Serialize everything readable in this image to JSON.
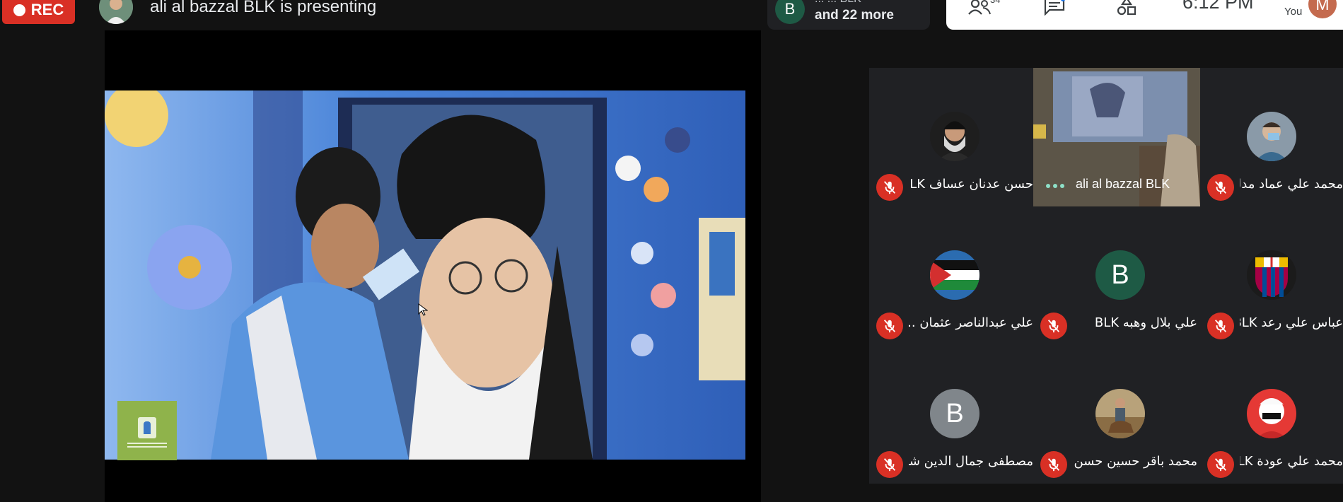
{
  "recording": {
    "label": "REC",
    "color": "#d93025"
  },
  "presenter": {
    "text": "ali al bazzal BLK is presenting"
  },
  "people_chip": {
    "avatar_letter": "B",
    "top_text": "... ...  BLK",
    "more_text": "and 22 more"
  },
  "toolbar": {
    "participant_count": "34",
    "time": "6:12 PM",
    "you_label": "You",
    "self_initial": "M",
    "icons": [
      "participants-icon",
      "chat-icon",
      "activities-icon"
    ]
  },
  "participants": [
    {
      "name": "حسن عدنان عساف BLK",
      "avatar": "photo",
      "muted": true
    },
    {
      "name": "ali al bazzal BLK",
      "avatar": "video",
      "muted": false,
      "speaking": true
    },
    {
      "name": "محمد علي عماد مدلج",
      "avatar": "photo",
      "muted": true
    },
    {
      "name": "علي عبدالناصر عثمان ...",
      "avatar": "flag",
      "muted": true
    },
    {
      "name": "علي بلال وهبه BLK",
      "avatar_letter": "B",
      "avatar_color": "#1e5a45",
      "muted": true
    },
    {
      "name": "عباس علي رعد BLK",
      "avatar": "club-crest",
      "muted": true
    },
    {
      "name": "مصطفى جمال الدين شمس...",
      "avatar_letter": "B",
      "avatar_color": "#80868b",
      "muted": true
    },
    {
      "name": "محمد باقر حسين حسن ...",
      "avatar": "photo",
      "muted": true
    },
    {
      "name": "محمد علي عودة BLK",
      "avatar": "photo",
      "muted": true
    }
  ]
}
